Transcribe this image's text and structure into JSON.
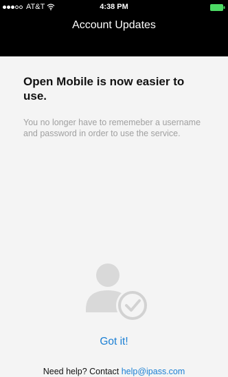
{
  "status_bar": {
    "carrier": "AT&T",
    "time": "4:38 PM",
    "signal_filled": 3,
    "signal_total": 5,
    "icons": [
      "wifi-icon",
      "battery-icon"
    ]
  },
  "nav": {
    "title": "Account Updates"
  },
  "main": {
    "headline": "Open Mobile is now easier to use.",
    "body": "You no longer have to rememeber a username and password in order to use the service.",
    "illustration_icon": "user-check-icon",
    "got_it_label": "Got it!"
  },
  "footer": {
    "help_prefix": "Need help? Contact ",
    "help_email": "help@ipass.com"
  },
  "colors": {
    "bar_background": "#000000",
    "content_background": "#f4f4f4",
    "link": "#1a7fd4",
    "muted_text": "#a0a0a0",
    "battery": "#4cd964"
  }
}
